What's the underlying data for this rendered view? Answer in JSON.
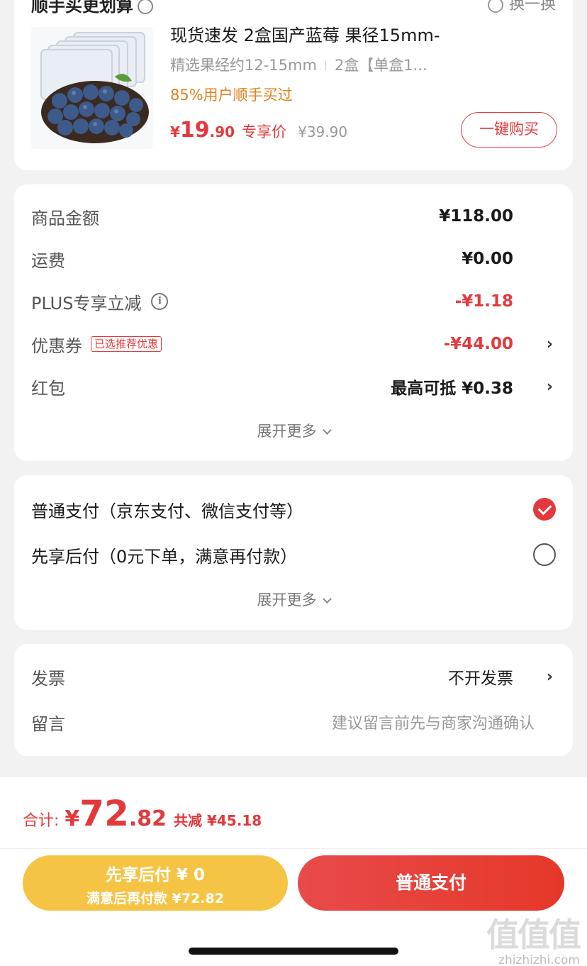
{
  "product_card": {
    "header_title": "顺手买更划算",
    "header_right": "换一换",
    "product": {
      "title": "现货速发 2盒国产蓝莓 果径15mm-",
      "spec_1": "精选果经约12-15mm",
      "spec_2": "2盒【单盒1...",
      "buyers": "85%用户顺手买过",
      "price_yen": "¥",
      "price_int": "19",
      "price_dec": ".90",
      "price_tag": "专享价",
      "original_price": "¥39.90",
      "buy_button": "一键购买"
    }
  },
  "fees": {
    "items": [
      {
        "label": "商品金额",
        "value": "¥118.00"
      },
      {
        "label": "运费",
        "value": "¥0.00"
      },
      {
        "label": "PLUS专享立减",
        "value": "-¥1.18"
      },
      {
        "label": "优惠券",
        "badge": "已选推荐优惠",
        "value": "-¥44.00"
      },
      {
        "label": "红包",
        "value": "最高可抵 ¥0.38"
      }
    ],
    "expand_label": "展开更多"
  },
  "payment": {
    "options": [
      {
        "label": "普通支付（京东支付、微信支付等）",
        "selected": true
      },
      {
        "label": "先享后付（0元下单，满意再付款）",
        "selected": false
      }
    ],
    "expand_label": "展开更多"
  },
  "invoice": {
    "invoice_label": "发票",
    "invoice_value": "不开发票",
    "message_label": "留言",
    "message_placeholder": "建议留言前先与商家沟通确认"
  },
  "footer": {
    "total_label": "合计:",
    "total_yen": "¥",
    "total_int": "72",
    "total_dec": ".82",
    "saving": "共减 ¥45.18",
    "later_line1": "先享后付 ¥ 0",
    "later_line2": "满意后再付款 ¥72.82",
    "pay_button": "普通支付"
  },
  "watermark": {
    "logo": "值值值",
    "url": "zhizhizhi.com"
  },
  "colors": {
    "accent_red": "#e4393c",
    "orange": "#e0801c",
    "yellow_button": "#f6c445"
  }
}
